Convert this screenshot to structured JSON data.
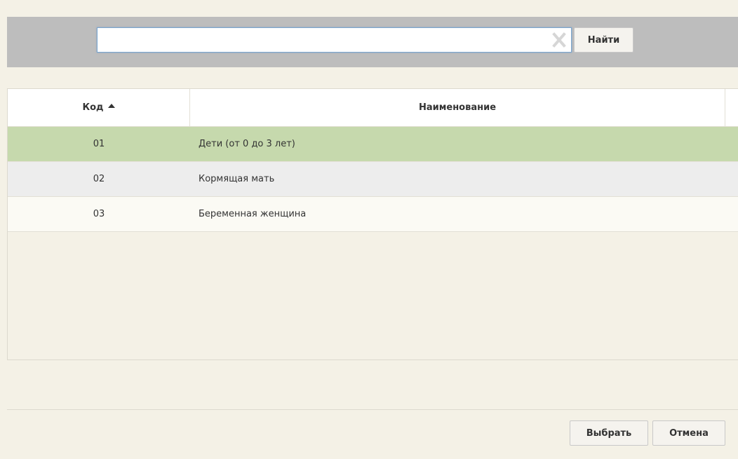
{
  "search": {
    "value": "",
    "placeholder": "",
    "find_label": "Найти"
  },
  "table": {
    "columns": [
      {
        "label": "Код",
        "sorted": "asc"
      },
      {
        "label": "Наименование"
      }
    ],
    "rows": [
      {
        "code": "01",
        "name": "Дети (от 0 до 3 лет)",
        "selected": true
      },
      {
        "code": "02",
        "name": "Кормящая мать"
      },
      {
        "code": "03",
        "name": "Беременная женщина"
      }
    ]
  },
  "footer": {
    "select_label": "Выбрать",
    "cancel_label": "Отмена"
  },
  "colors": {
    "selected_row": "#c6d9ad",
    "search_bar": "#bdbdbd",
    "background": "#f4f1e6"
  },
  "icons": {
    "clear": "close-x-icon",
    "sort": "sort-ascending-icon"
  }
}
